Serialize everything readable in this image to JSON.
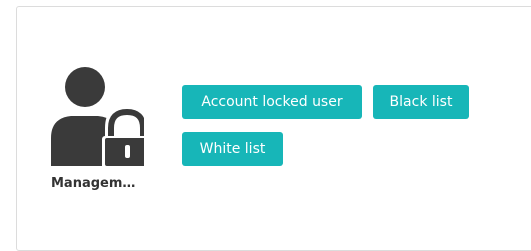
{
  "management": {
    "label": "Managem…",
    "icon": "user-lock-icon"
  },
  "buttons": {
    "account_locked_user": "Account locked user",
    "black_list": "Black list",
    "white_list": "White list"
  },
  "colors": {
    "button_bg": "#17b6b8",
    "button_text": "#ffffff",
    "icon": "#3a3a3a",
    "label": "#333333"
  }
}
